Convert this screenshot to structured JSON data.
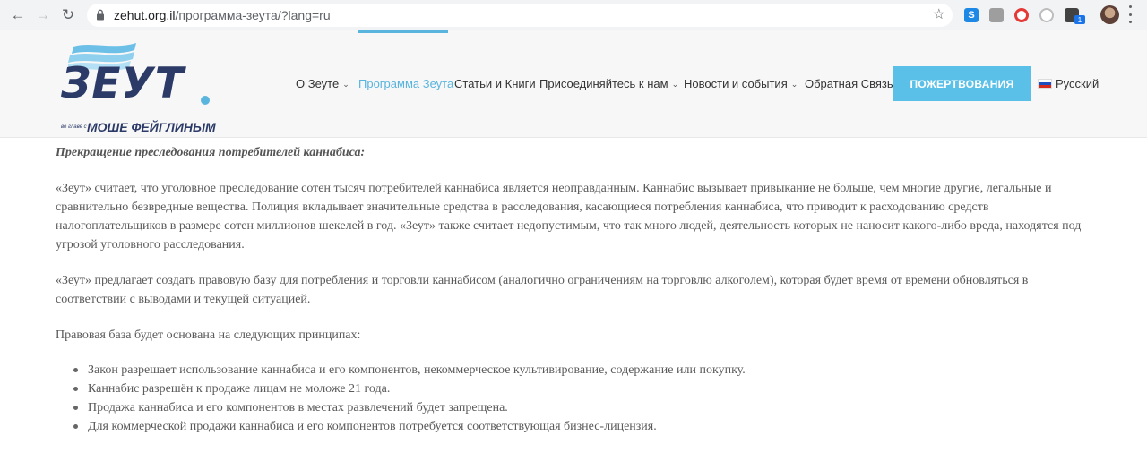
{
  "browser": {
    "url_host": "zehut.org.il",
    "url_path": "/программа-зеута/?lang=ru",
    "extension_badge": "1",
    "extension_s_label": "S"
  },
  "site": {
    "logo_text": "ЗЕУТ",
    "logo_sub_small": "во главе с",
    "logo_sub": "МОШЕ ФЕЙГЛИНЫМ",
    "menu": [
      {
        "label": "О Зеуте",
        "dropdown": true
      },
      {
        "label": "Программа Зеута",
        "dropdown": false
      },
      {
        "label": "Статьи и Книги",
        "dropdown": false
      },
      {
        "label": "Присоединяйтесь к нам",
        "dropdown": true
      },
      {
        "label": "Новости и события",
        "dropdown": true
      },
      {
        "label": "Обратная Связь",
        "dropdown": false
      }
    ],
    "donate_label": "ПОЖЕРТВОВАНИЯ",
    "language": "Русский",
    "accent_color": "#59b4de",
    "brand_color": "#2b3a67"
  },
  "content": {
    "heading": "Прекращение преследования потребителей каннабиса:",
    "p1": "«Зеут» считает, что уголовное преследование сотен тысяч потребителей каннабиса является неоправданным. Каннабис вызывает привыкание не больше, чем многие другие, легальные и сравнительно безвредные вещества. Полиция вкладывает значительные средства в расследования, касающиеся потребления каннабиса, что приводит к расходованию средств налогоплательщиков в размере сотен миллионов шекелей в год. «Зеут» также считает недопустимым, что так много людей, деятельность которых не наносит какого-либо вреда, находятся под угрозой уголовного расследования.",
    "p2": "«Зеут» предлагает создать правовую базу для потребления и торговли каннабисом (аналогично ограничениям на торговлю алкоголем), которая будет время от времени обновляться в соответствии с выводами и текущей ситуацией.",
    "p3": "Правовая база будет основана на следующих принципах:",
    "bullets": [
      "Закон разрешает использование каннабиса и его компонентов, некоммерческое культивирование, содержание или покупку.",
      "Каннабис разрешён к продаже лицам не моложе 21 года.",
      "Продажа каннабиса и его компонентов в местах развлечений будет запрещена.",
      "Для коммерческой продажи каннабиса и его компонентов потребуется соответствующая бизнес-лицензия."
    ]
  }
}
